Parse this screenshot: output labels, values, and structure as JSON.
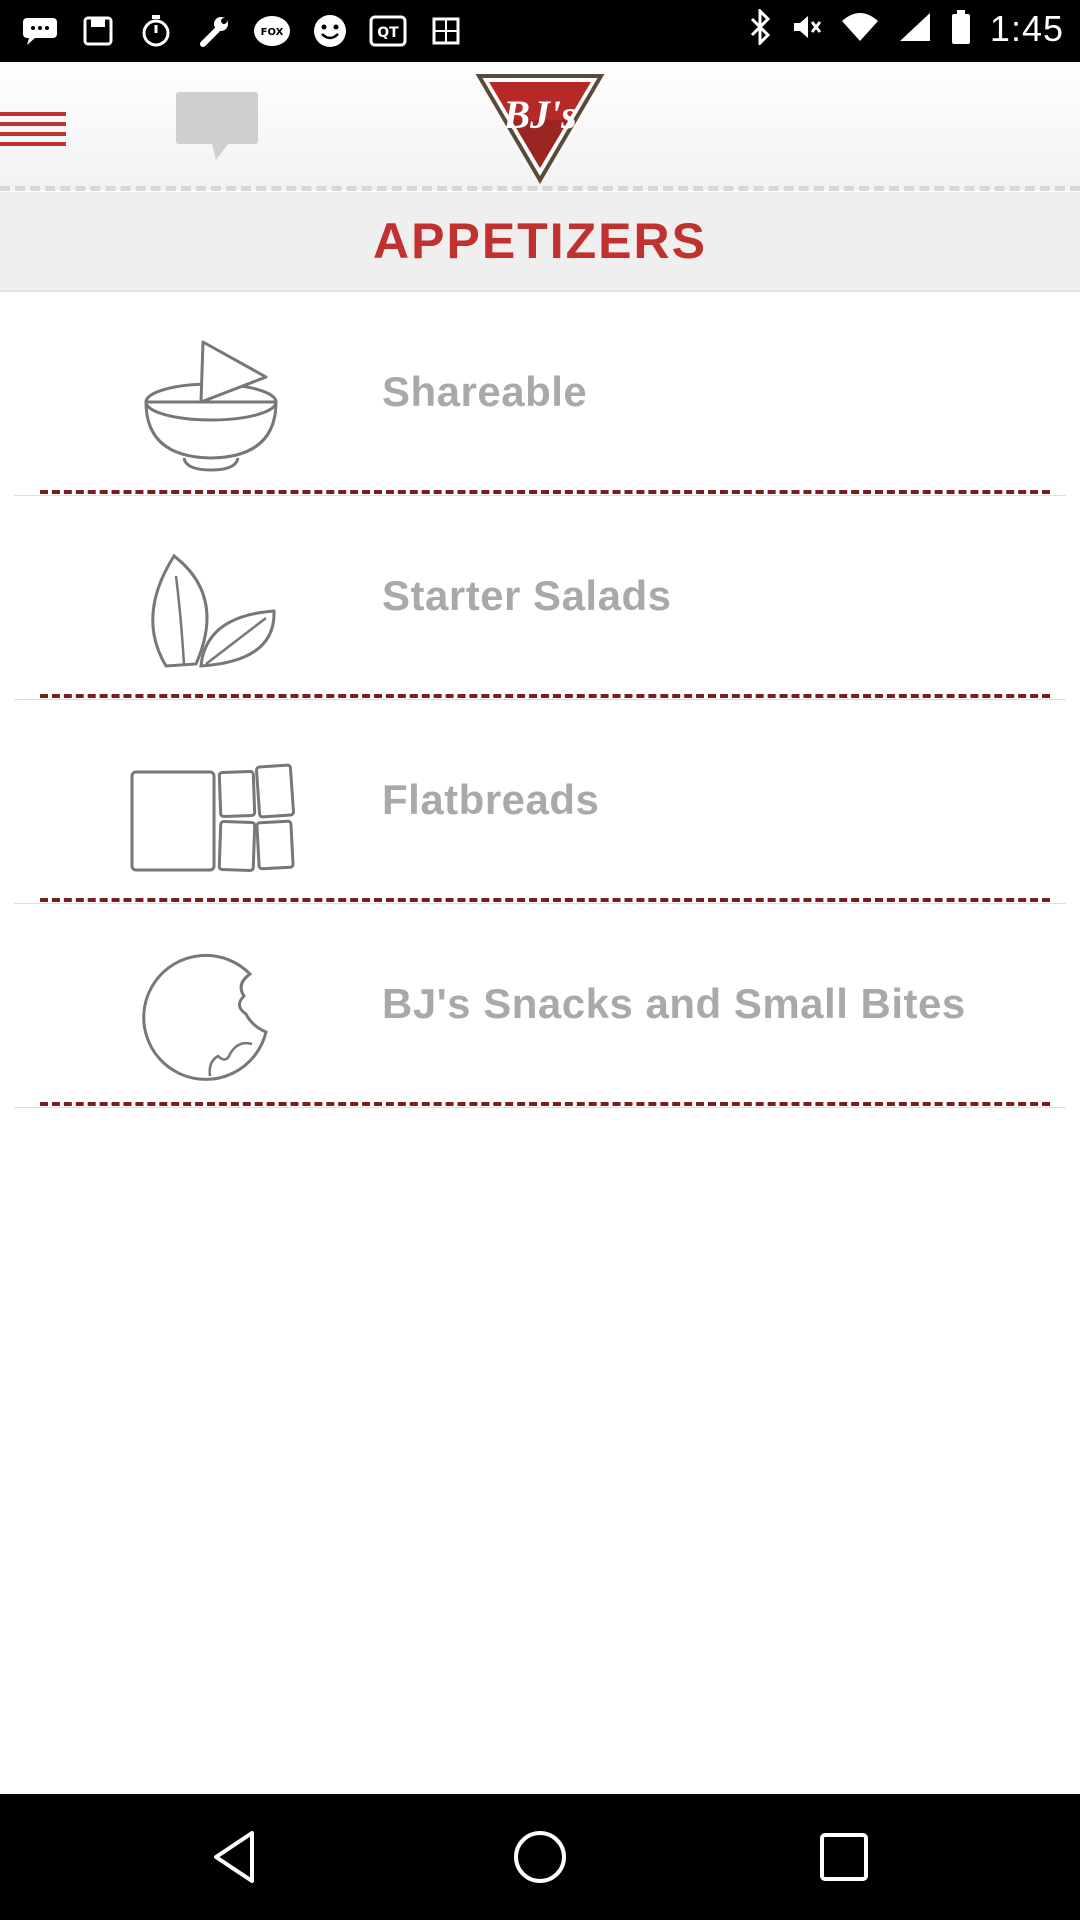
{
  "status_bar": {
    "time": "1:45",
    "icons": [
      "chat-bubble-icon",
      "save-icon",
      "stopwatch-icon",
      "wrench-icon",
      "fox-sports-icon",
      "smiley-icon",
      "qt-icon",
      "square-icon",
      "bluetooth-icon",
      "mute-icon",
      "wifi-icon",
      "signal-icon",
      "battery-icon"
    ]
  },
  "header": {
    "logo_text": "BJ's",
    "accent_color": "#c0312f"
  },
  "section": {
    "title": "APPETIZERS"
  },
  "menu_items": [
    {
      "label": "Shareable",
      "icon": "bowl-icon"
    },
    {
      "label": "Starter Salads",
      "icon": "leaves-icon"
    },
    {
      "label": "Flatbreads",
      "icon": "flatbread-icon"
    },
    {
      "label": "BJ's Snacks and Small Bites",
      "icon": "bitten-cookie-icon"
    }
  ],
  "nav": {
    "buttons": [
      "back-icon",
      "home-icon",
      "recents-icon"
    ]
  }
}
